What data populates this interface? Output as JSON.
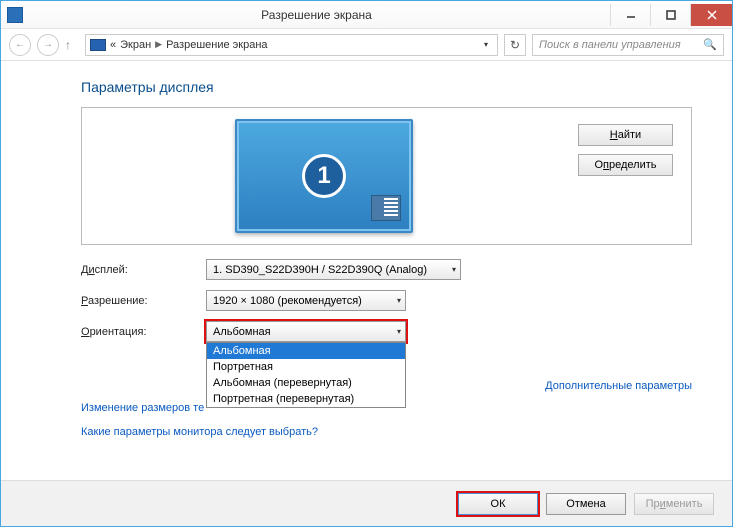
{
  "window": {
    "title": "Разрешение экрана"
  },
  "breadcrumb": {
    "sep": "«",
    "item1": "Экран",
    "item2": "Разрешение экрана"
  },
  "toolbar": {
    "search_placeholder": "Поиск в панели управления"
  },
  "headings": {
    "main": "Параметры дисплея"
  },
  "preview": {
    "monitor_number": "1"
  },
  "buttons": {
    "find": "Найти",
    "identify": "Определить",
    "ok": "ОК",
    "cancel": "Отмена",
    "apply": "Применить"
  },
  "labels": {
    "display": "Дисплей:",
    "resolution": "Разрешение:",
    "orientation": "Ориентация:"
  },
  "values": {
    "display": "1. SD390_S22D390H / S22D390Q (Analog)",
    "resolution": "1920 × 1080 (рекомендуется)",
    "orientation": "Альбомная"
  },
  "orientation_options": [
    "Альбомная",
    "Портретная",
    "Альбомная (перевернутая)",
    "Портретная (перевернутая)"
  ],
  "links": {
    "text_size": "Изменение размеров те",
    "which_monitor": "Какие параметры монитора следует выбрать?",
    "advanced": "Дополнительные параметры"
  }
}
